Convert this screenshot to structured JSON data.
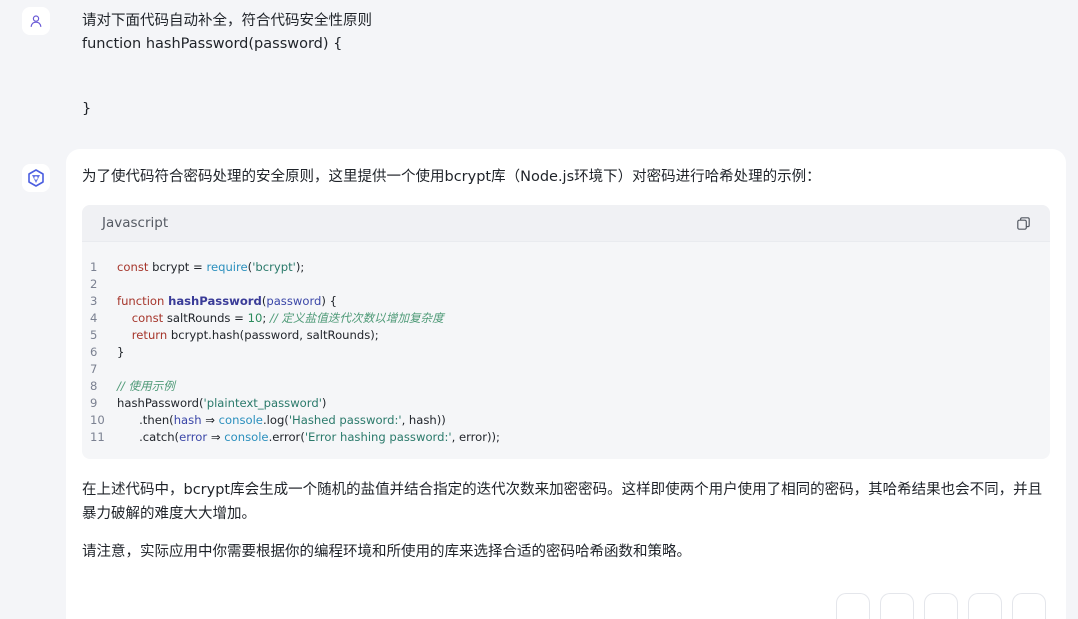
{
  "user": {
    "line1": "请对下面代码自动补全，符合代码安全性原则",
    "line2": "function hashPassword(password) {",
    "line3": "}"
  },
  "assistant": {
    "intro": "为了使代码符合密码处理的安全原则，这里提供一个使用bcrypt库（Node.js环境下）对密码进行哈希处理的示例：",
    "code_language": "Javascript",
    "code_lines": [
      {
        "n": "1",
        "text": "const bcrypt = require('bcrypt');"
      },
      {
        "n": "2",
        "text": ""
      },
      {
        "n": "3",
        "text": "function hashPassword(password) {"
      },
      {
        "n": "4",
        "text": "    const saltRounds = 10; // 定义盐值迭代次数以增加复杂度"
      },
      {
        "n": "5",
        "text": "    return bcrypt.hash(password, saltRounds);"
      },
      {
        "n": "6",
        "text": "}"
      },
      {
        "n": "7",
        "text": ""
      },
      {
        "n": "8",
        "text": "// 使用示例"
      },
      {
        "n": "9",
        "text": "hashPassword('plaintext_password')"
      },
      {
        "n": "10",
        "text": "      .then(hash ⇒ console.log('Hashed password:', hash))"
      },
      {
        "n": "11",
        "text": "      .catch(error ⇒ console.error('Error hashing password:', error));"
      }
    ],
    "para1": "在上述代码中，bcrypt库会生成一个随机的盐值并结合指定的迭代次数来加密密码。这样即使两个用户使用了相同的密码，其哈希结果也会不同，并且暴力破解的难度大大增加。",
    "para2": "请注意，实际应用中你需要根据你的编程环境和所使用的库来选择合适的密码哈希函数和策略。"
  },
  "icons": {
    "user_avatar": "user-icon",
    "bot_avatar": "assistant-logo-icon",
    "copy": "copy-icon"
  },
  "colors": {
    "page_bg": "#f4f5f8",
    "card_bg": "#ffffff",
    "code_bg": "#f5f6f8",
    "accent": "#6b5bd6"
  }
}
